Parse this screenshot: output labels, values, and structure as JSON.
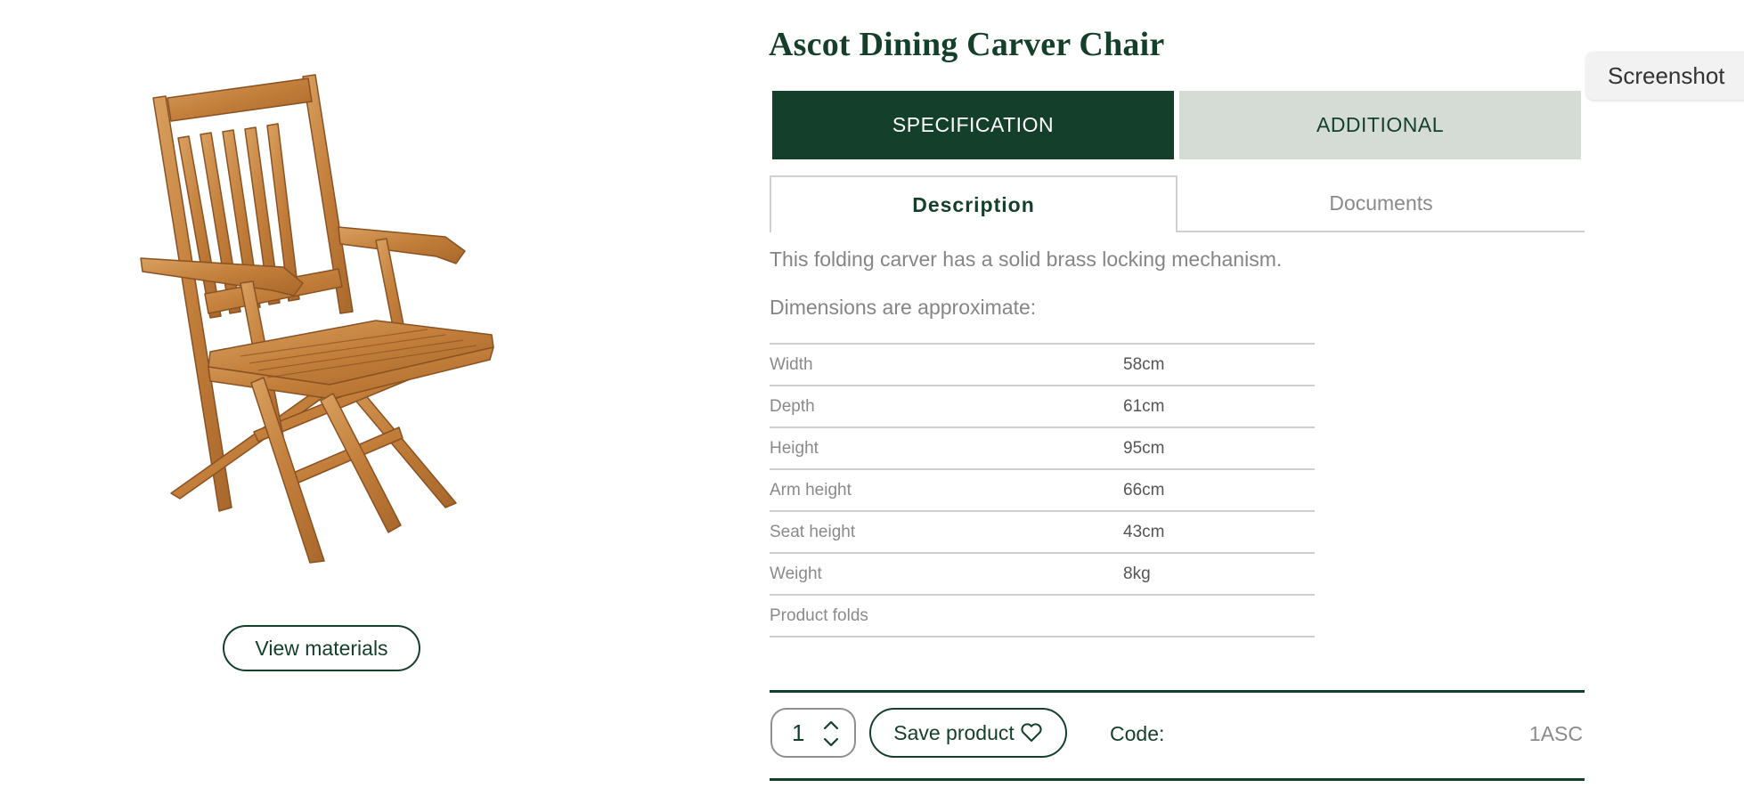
{
  "product": {
    "title": "Ascot Dining Carver Chair",
    "image_alt": "Teak folding carver chair"
  },
  "view_materials_label": "View materials",
  "main_tabs": [
    {
      "label": "SPECIFICATION",
      "active": true
    },
    {
      "label": "ADDITIONAL",
      "active": false
    }
  ],
  "sub_tabs": [
    {
      "label": "Description",
      "active": true
    },
    {
      "label": "Documents",
      "active": false
    }
  ],
  "description": "This folding carver has a solid brass locking mechanism.",
  "dimensions_note": "Dimensions are approximate:",
  "specs": [
    {
      "label": "Width",
      "value": "58cm"
    },
    {
      "label": "Depth",
      "value": "61cm"
    },
    {
      "label": "Height",
      "value": "95cm"
    },
    {
      "label": "Arm height",
      "value": "66cm"
    },
    {
      "label": "Seat height",
      "value": "43cm"
    },
    {
      "label": "Weight",
      "value": "8kg"
    },
    {
      "label": "Product folds",
      "value": ""
    }
  ],
  "purchase": {
    "quantity": "1",
    "save_label": "Save product",
    "code_label": "Code:",
    "code_value": "1ASC"
  },
  "overlay": {
    "screenshot_label": "Screenshot"
  },
  "colors": {
    "brand_green": "#143f2a",
    "tab_inactive_bg": "#d5dbd5",
    "teak": "#c9883f"
  },
  "icons": {
    "quantity_stepper": "chevron-up-down-icon",
    "save": "heart-outline-icon"
  }
}
